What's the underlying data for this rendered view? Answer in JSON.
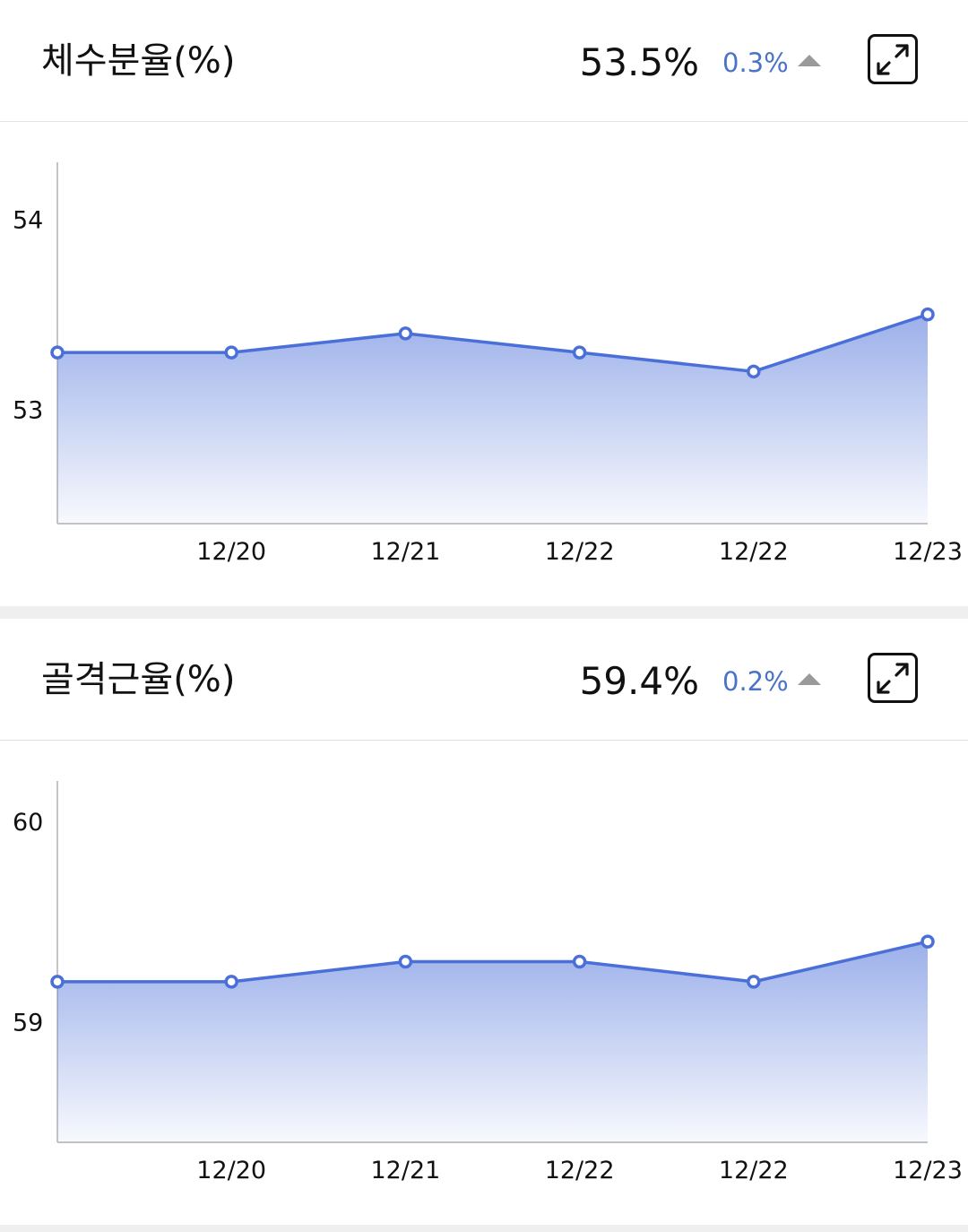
{
  "metrics": [
    {
      "title": "체수분율(%)",
      "value": "53.5%",
      "delta": "0.3%",
      "delta_direction": "up",
      "expand_icon": "expand-arrows-icon",
      "chart_data": {
        "type": "area",
        "x": [
          "",
          "12/20",
          "12/21",
          "12/22",
          "12/22",
          "12/23"
        ],
        "series": [
          {
            "values": [
              53.3,
              53.3,
              53.4,
              53.3,
              53.2,
              53.5
            ]
          }
        ],
        "ylim": [
          52.4,
          54.3
        ],
        "y_ticks": [
          "54",
          "53"
        ],
        "y_tick_values": [
          54,
          53
        ],
        "color": "#4a6fd8"
      }
    },
    {
      "title": "골격근율(%)",
      "value": "59.4%",
      "delta": "0.2%",
      "delta_direction": "up",
      "expand_icon": "expand-arrows-icon",
      "chart_data": {
        "type": "area",
        "x": [
          "",
          "12/20",
          "12/21",
          "12/22",
          "12/22",
          "12/23"
        ],
        "series": [
          {
            "values": [
              59.2,
              59.2,
              59.3,
              59.3,
              59.2,
              59.4
            ]
          }
        ],
        "ylim": [
          58.4,
          60.2
        ],
        "y_ticks": [
          "60",
          "59"
        ],
        "y_tick_values": [
          60,
          59
        ],
        "color": "#4a6fd8"
      }
    }
  ]
}
